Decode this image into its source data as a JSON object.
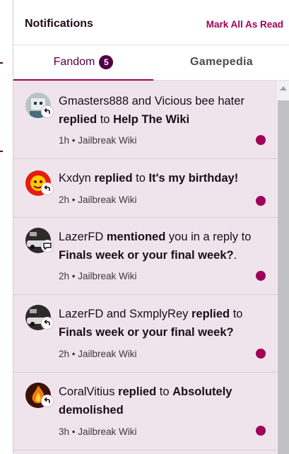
{
  "header": {
    "title": "Notifications",
    "mark_all_label": "Mark All As Read"
  },
  "tabs": [
    {
      "label": "Fandom",
      "badge": "5"
    },
    {
      "label": "Gamepedia"
    }
  ],
  "notifications": [
    {
      "actor": "Gmasters888 and Vicious bee hater",
      "action": "replied",
      "joiner": "to",
      "target": "Help The Wiki",
      "time": "1h",
      "wiki": "Jailbreak Wiki",
      "type_icon": "reply-icon",
      "avatar": "robot-avatar"
    },
    {
      "actor": "Kxdyn",
      "action": "replied",
      "joiner": "to",
      "target": "It's my birthday!",
      "time": "2h",
      "wiki": "Jailbreak Wiki",
      "type_icon": "reply-icon",
      "avatar": "red-avatar"
    },
    {
      "actor": "LazerFD",
      "action": "mentioned",
      "joiner": "you in a reply to",
      "target": "Finals week or your final week?",
      "suffix": ".",
      "time": "2h",
      "wiki": "Jailbreak Wiki",
      "type_icon": "mention-icon",
      "avatar": "car-avatar"
    },
    {
      "actor": "LazerFD and SxmplyRey",
      "action": "replied",
      "joiner": "to",
      "target": "Finals week or your final week?",
      "time": "2h",
      "wiki": "Jailbreak Wiki",
      "type_icon": "reply-icon",
      "avatar": "car-avatar"
    },
    {
      "actor": "CoralVitius",
      "action": "replied",
      "joiner": "to",
      "target": "Absolutely demolished",
      "time": "3h",
      "wiki": "Jailbreak Wiki",
      "type_icon": "reply-icon",
      "avatar": "fire-avatar"
    }
  ],
  "colors": {
    "accent": "#a1005a",
    "badge": "#520044",
    "unread_bg": "#efe4ec"
  }
}
